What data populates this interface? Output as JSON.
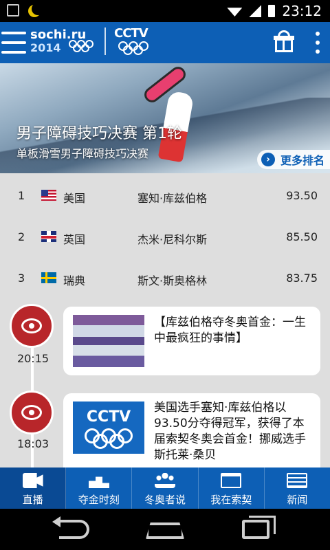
{
  "status_bar": {
    "time": "23:12"
  },
  "header": {
    "logo_sochi_line1": "sochi.ru",
    "logo_sochi_line2": "2014",
    "logo_cctv": "CCTV",
    "brand_color": "#0d5fb5"
  },
  "hero": {
    "title": "男子障碍技巧决赛 第1轮",
    "subtitle": "单板滑雪男子障碍技巧决赛",
    "more_label": "更多排名"
  },
  "rankings": [
    {
      "rank": "1",
      "flag": "us-flag",
      "country": "美国",
      "athlete": "塞知·库兹伯格",
      "score": "93.50"
    },
    {
      "rank": "2",
      "flag": "gb-flag",
      "country": "英国",
      "athlete": "杰米·尼科尔斯",
      "score": "85.50"
    },
    {
      "rank": "3",
      "flag": "se-flag",
      "country": "瑞典",
      "athlete": "斯文·斯奥格林",
      "score": "83.75"
    }
  ],
  "feed": [
    {
      "time": "20:15",
      "source_icon": "weibo-icon",
      "text": "【库兹伯格夺冬奥首金：一生中最疯狂的事情】"
    },
    {
      "time": "18:03",
      "source_icon": "weibo-icon",
      "text": "美国选手塞知·库兹伯格以93.50分夺得冠军，获得了本届索契冬奥会首金！挪威选手斯托莱·桑贝"
    }
  ],
  "bottom_nav": [
    {
      "label": "直播",
      "icon": "video-camera-icon",
      "active": true
    },
    {
      "label": "夺金时刻",
      "icon": "podium-icon",
      "active": false
    },
    {
      "label": "冬奥者说",
      "icon": "people-icon",
      "active": false
    },
    {
      "label": "我在索契",
      "icon": "calendar-icon",
      "active": false
    },
    {
      "label": "新闻",
      "icon": "news-icon",
      "active": false
    }
  ]
}
